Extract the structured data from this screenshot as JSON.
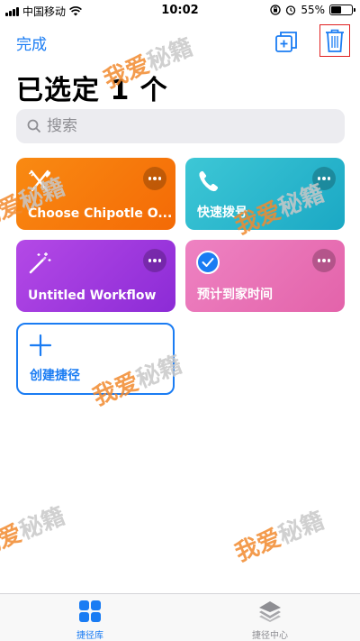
{
  "status_bar": {
    "carrier": "中国移动",
    "time": "10:02",
    "battery_percent": "55%",
    "battery_level": 0.55
  },
  "nav": {
    "done_label": "完成",
    "duplicate_icon": "duplicate-icon",
    "trash_icon": "trash-icon"
  },
  "title": "已选定 1 个",
  "search": {
    "placeholder": "搜索"
  },
  "shortcuts": [
    {
      "label": "Choose Chipotle O...",
      "icon": "fork-knife-icon",
      "color": "#f47b0c",
      "selected": false
    },
    {
      "label": "快速拨号",
      "icon": "phone-icon",
      "color": "#2bb8cd",
      "selected": false
    },
    {
      "label": "Untitled Workflow",
      "icon": "magic-wand-icon",
      "color": "#a03ade",
      "selected": false
    },
    {
      "label": "预计到家时间",
      "icon": "checkmark-icon",
      "color": "#e872b6",
      "selected": true
    }
  ],
  "create": {
    "label": "创建捷径"
  },
  "watermark": {
    "part_a": "我爱",
    "part_b": "秘籍"
  },
  "tab_bar": {
    "tabs": [
      {
        "label": "捷径库",
        "icon": "grid-icon",
        "active": true
      },
      {
        "label": "捷径中心",
        "icon": "layers-icon",
        "active": false
      }
    ]
  },
  "colors": {
    "accent": "#1a7cf3",
    "highlight_border": "#e02020"
  }
}
